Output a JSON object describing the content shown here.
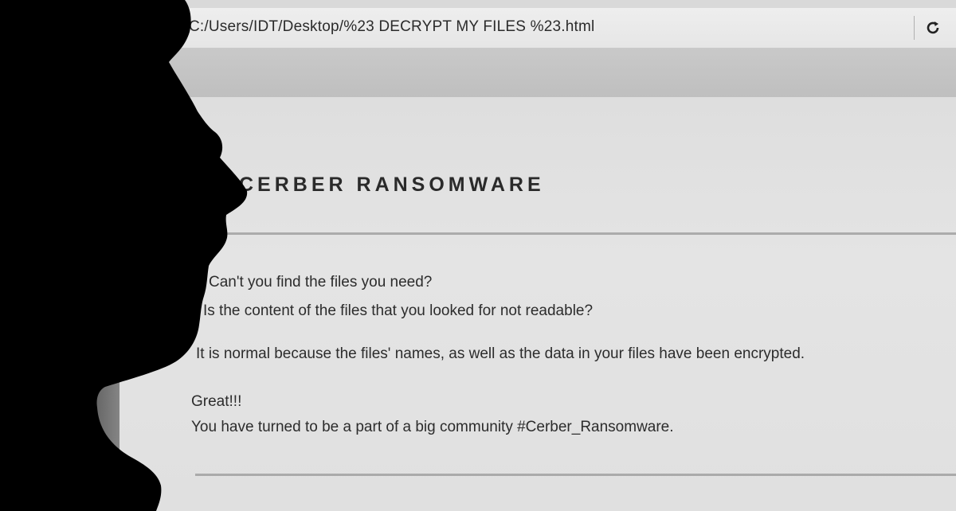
{
  "browser": {
    "url": "file:///C:/Users/IDT/Desktop/%23 DECRYPT MY FILES %23.html",
    "reload_icon": "reload-icon"
  },
  "page": {
    "title": "CERBER RANSOMWARE",
    "lines": [
      "Can't you find the files you need?",
      "Is the content of the files that you looked for not readable?",
      "It is normal because the files' names, as well as the data in your files have been encrypted.",
      "Great!!!",
      "You have turned to be a part of a big community #Cerber_Ransomware."
    ]
  },
  "colors": {
    "page_background": "#e0e0e0",
    "text": "#2c2c2c",
    "silhouette": "#000000"
  }
}
